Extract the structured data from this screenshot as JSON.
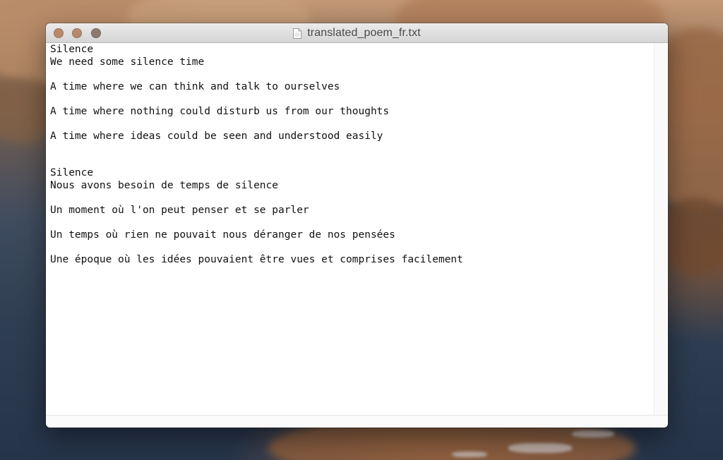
{
  "window": {
    "title": "translated_poem_fr.txt",
    "file_icon": "text-document-icon",
    "controls": [
      "close-button",
      "minimize-button",
      "zoom-button"
    ]
  },
  "document": {
    "lines": [
      "Silence",
      "We need some silence time",
      "",
      "A time where we can think and talk to ourselves",
      "",
      "A time where nothing could disturb us from our thoughts",
      "",
      "A time where ideas could be seen and understood easily",
      "",
      "",
      "Silence",
      "Nous avons besoin de temps de silence",
      "",
      "Un moment où l'on peut penser et se parler",
      "",
      "Un temps où rien ne pouvait nous déranger de nos pensées",
      "",
      "Une époque où les idées pouvaient être vues et comprises facilement"
    ]
  },
  "colors": {
    "close": "#b88a6c",
    "minimize": "#b6896c",
    "zoom": "#8e7a70",
    "text": "#111111"
  }
}
